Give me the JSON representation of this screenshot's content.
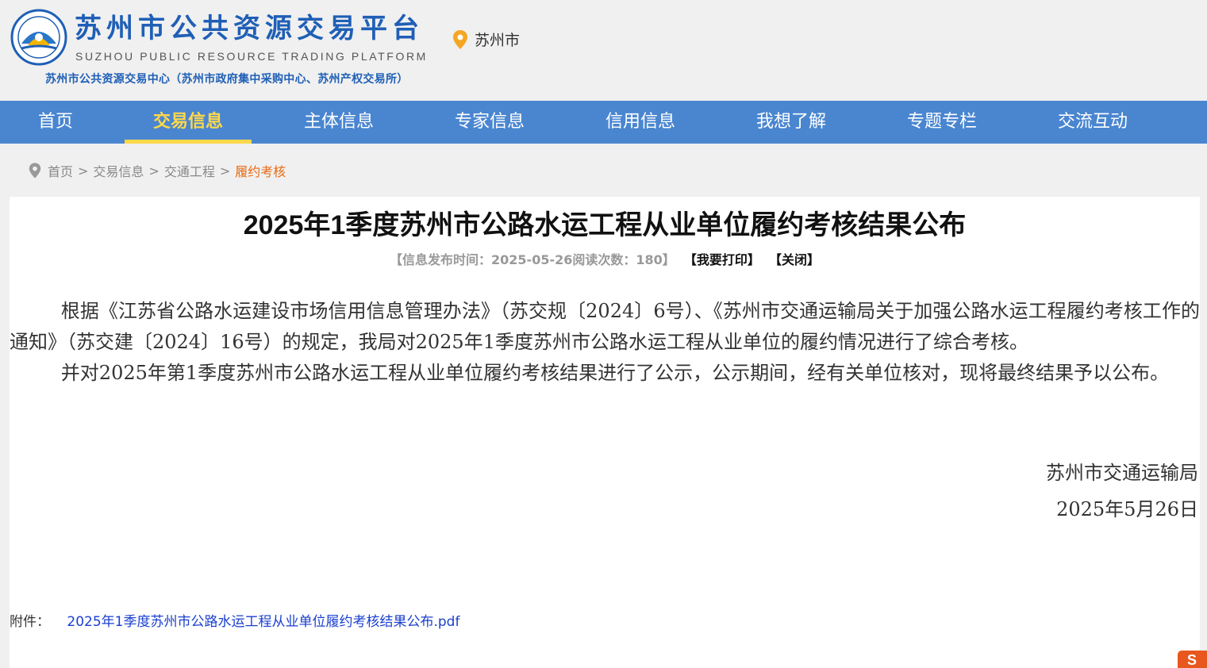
{
  "header": {
    "title": "苏州市公共资源交易平台",
    "subtitle_en": "SUZHOU PUBLIC RESOURCE TRADING PLATFORM",
    "org": "苏州市公共资源交易中心（苏州市政府集中采购中心、苏州产权交易所）",
    "location": "苏州市",
    "location_icon": "map-pin-icon"
  },
  "nav": {
    "items": [
      {
        "label": "首页"
      },
      {
        "label": "交易信息",
        "active": true
      },
      {
        "label": "主体信息"
      },
      {
        "label": "专家信息"
      },
      {
        "label": "信用信息"
      },
      {
        "label": "我想了解"
      },
      {
        "label": "专题专栏"
      },
      {
        "label": "交流互动"
      }
    ]
  },
  "breadcrumb": {
    "items": [
      "首页",
      "交易信息",
      "交通工程"
    ],
    "current": "履约考核",
    "separator": ">"
  },
  "article": {
    "title": "2025年1季度苏州市公路水运工程从业单位履约考核结果公布",
    "meta": "【信息发布时间：2025-05-26阅读次数：180】",
    "print_label": "【我要打印】",
    "close_label": "【关闭】",
    "paragraphs": [
      "根据《江苏省公路水运建设市场信用信息管理办法》（苏交规〔2024〕6号）、《苏州市交通运输局关于加强公路水运工程履约考核工作的通知》（苏交建〔2024〕16号）的规定，我局对2025年1季度苏州市公路水运工程从业单位的履约情况进行了综合考核。",
      "并对2025年第1季度苏州市公路水运工程从业单位履约考核结果进行了公示，公示期间，经有关单位核对，现将最终结果予以公布。"
    ],
    "signature": "苏州市交通运输局",
    "date": "2025年5月26日",
    "attachment_label": "附件：",
    "attachment_name": "2025年1季度苏州市公路水运工程从业单位履约考核结果公布.pdf"
  },
  "colors": {
    "nav_bg": "#4a86d0",
    "nav_active": "#ffd84a",
    "brand_blue": "#1f5fb6",
    "breadcrumb_current": "#e8690f",
    "link": "#1a3fcf"
  }
}
